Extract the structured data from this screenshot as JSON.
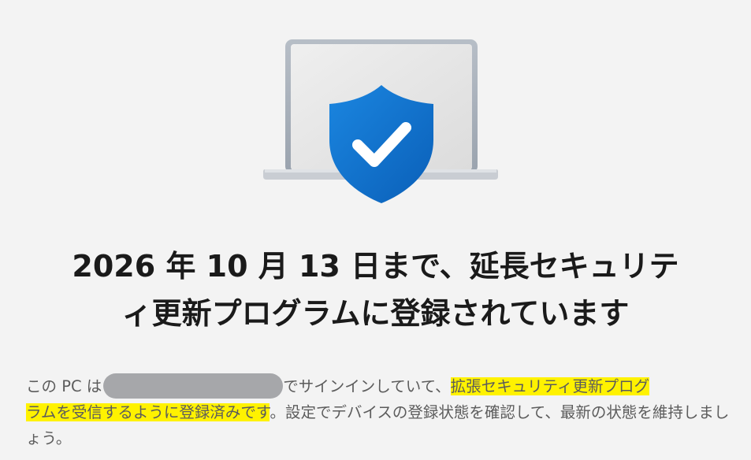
{
  "hero": {
    "icon": "laptop-shield-check-icon",
    "colors": {
      "shield": "#0a72cf",
      "screen": "#e6e6e6",
      "frame": "#a9b1bb",
      "base": "#c9cdd3"
    }
  },
  "headline": {
    "line1": "2026 年 10 月 13 日まで、延長セキュリテ",
    "line2": "ィ更新プログラムに登録されています"
  },
  "body": {
    "prefix": "この PC は",
    "after_account": "でサインインしていて、",
    "highlight_line1": "拡張セキュリティ更新プログ",
    "highlight_line2": "ラムを受信するように登録済みです",
    "suffix": "。設定でデバイスの登録状態を確認して、最新の状態を維持しましょう。",
    "highlight_color": "#fff200",
    "redaction_color": "#a6a7aa"
  }
}
